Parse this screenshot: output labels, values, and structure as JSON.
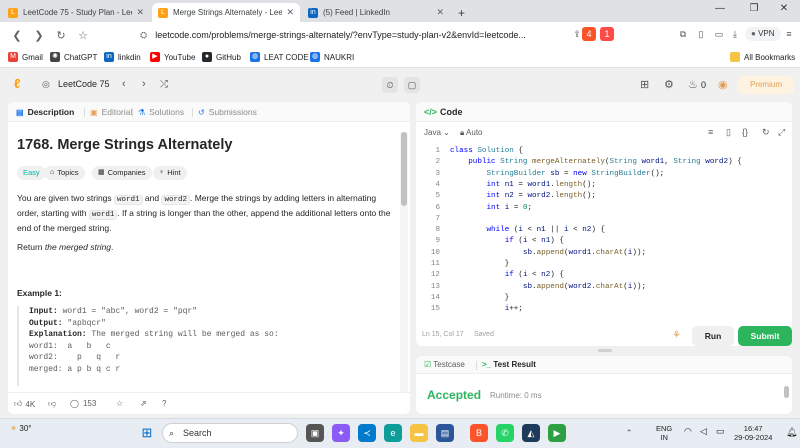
{
  "browser": {
    "tabs": [
      {
        "title": "LeetCode 75 - Study Plan - Lee",
        "active": false
      },
      {
        "title": "Merge Strings Alternately - Lee",
        "active": true
      },
      {
        "title": "(5) Feed | LinkedIn",
        "active": false
      }
    ],
    "new_tab": "+",
    "url": "leetcode.com/problems/merge-strings-alternately/?envType=study-plan-v2&envId=leetcode...",
    "vpn_label": "VPN",
    "bookmarks": [
      "Gmail",
      "ChatGPT",
      "linkdin",
      "YouTube",
      "GitHub",
      "LEAT CODE",
      "NAUKRI"
    ],
    "all_bookmarks": "All Bookmarks",
    "brave_badge": "4",
    "alert_badge": "1"
  },
  "header": {
    "list_title": "LeetCode 75",
    "streak": "0",
    "premium": "Premium"
  },
  "left_tabs": {
    "description": "Description",
    "editorial": "Editorial",
    "solutions": "Solutions",
    "submissions": "Submissions"
  },
  "problem": {
    "title": "1768. Merge Strings Alternately",
    "chips": [
      "Easy",
      "Topics",
      "Companies",
      "Hint"
    ],
    "para1_a": "You are given two strings ",
    "para1_code1": "word1",
    "para1_b": " and ",
    "para1_code2": "word2",
    "para1_c": ". Merge the strings by adding letters in alternating order, starting with ",
    "para1_code3": "word1",
    "para1_d": ". If a string is longer than the other, append the additional letters onto the end of the merged string.",
    "para2_a": "Return ",
    "para2_em": "the merged string",
    "para2_b": ".",
    "example_title": "Example 1:",
    "ex_input_label": "Input:",
    "ex_input": " word1 = \"abc\", word2 = \"pqr\"",
    "ex_output_label": "Output:",
    "ex_output": " \"apbqcr\"",
    "ex_expl_label": "Explanation:",
    "ex_expl": " The merged string will be merged as so:",
    "ex_line1": "word1:  a   b   c",
    "ex_line2": "word2:    p   q   r",
    "ex_line3": "merged: a p b q c r"
  },
  "footer": {
    "likes": "4K",
    "comments": "153"
  },
  "code": {
    "header": "Code",
    "language": "Java",
    "auto": "Auto",
    "status": "Ln 15, Col 17",
    "saved": "Saved",
    "run": "Run",
    "submit": "Submit",
    "lines": [
      {
        "n": "1",
        "t": "class Solution {"
      },
      {
        "n": "2",
        "t": "    public String mergeAlternately(String word1, String word2) {"
      },
      {
        "n": "3",
        "t": "        StringBuilder sb = new StringBuilder();"
      },
      {
        "n": "4",
        "t": "        int n1 = word1.length();"
      },
      {
        "n": "5",
        "t": "        int n2 = word2.length();"
      },
      {
        "n": "6",
        "t": "        int i = 0;"
      },
      {
        "n": "7",
        "t": ""
      },
      {
        "n": "8",
        "t": "        while (i < n1 || i < n2) {"
      },
      {
        "n": "9",
        "t": "            if (i < n1) {"
      },
      {
        "n": "10",
        "t": "                sb.append(word1.charAt(i));"
      },
      {
        "n": "11",
        "t": "            }"
      },
      {
        "n": "12",
        "t": "            if (i < n2) {"
      },
      {
        "n": "13",
        "t": "                sb.append(word2.charAt(i));"
      },
      {
        "n": "14",
        "t": "            }"
      },
      {
        "n": "15",
        "t": "            i++;"
      }
    ]
  },
  "result": {
    "testcase": "Testcase",
    "test_result": "Test Result",
    "status": "Accepted",
    "runtime": "Runtime: 0 ms"
  },
  "taskbar": {
    "weather": "30°",
    "search": "Search",
    "lang1": "ENG",
    "lang2": "IN",
    "time": "16:47",
    "date": "29-09-2024"
  },
  "colors": {
    "accent_green": "#2db55d",
    "premium_orange": "#e1a05a",
    "easy_teal": "#00b8a3"
  }
}
